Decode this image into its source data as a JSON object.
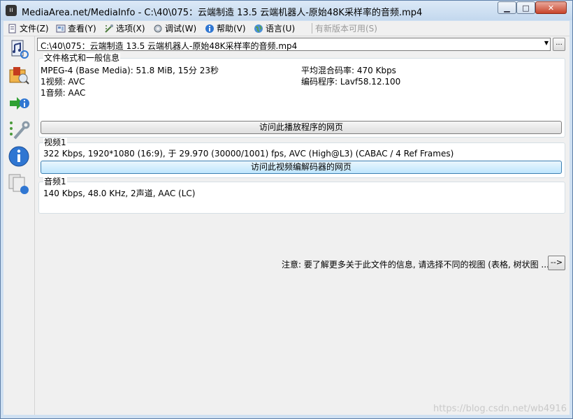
{
  "window": {
    "title": "MediaArea.net/MediaInfo - C:\\40\\075：云端制造 13.5 云端机器人-原始48K采样率的音频.mp4",
    "controls": {
      "minimize": "▁",
      "maximize": "□",
      "close": "✕"
    }
  },
  "menu": {
    "items": [
      {
        "label": "文件(Z)",
        "icon": "file-menu-icon"
      },
      {
        "label": "查看(Y)",
        "icon": "view-menu-icon"
      },
      {
        "label": "选项(X)",
        "icon": "options-menu-icon"
      },
      {
        "label": "调试(W)",
        "icon": "debug-menu-icon"
      },
      {
        "label": "帮助(V)",
        "icon": "help-menu-icon"
      },
      {
        "label": "语言(U)",
        "icon": "language-menu-icon"
      }
    ],
    "update_label": "有新版本可用(S)"
  },
  "file_select": {
    "value": "C:\\40\\075：云端制造 13.5 云端机器人-原始48K采样率的音频.mp4",
    "browse_label": "..."
  },
  "general": {
    "title": "文件格式和一般信息",
    "format": "MPEG-4 (Base Media): 51.8 MiB, 15分 23秒",
    "video_count": "1视频: AVC",
    "audio_count": "1音频: AAC",
    "bitrate": "平均混合码率: 470 Kbps",
    "encoder": "编码程序: Lavf58.12.100",
    "visit_button": "访问此播放程序的网页"
  },
  "video": {
    "title": "视频1",
    "info": "322 Kbps, 1920*1080 (16:9), 于 29.970 (30000/1001) fps, AVC (High@L3) (CABAC / 4 Ref Frames)",
    "visit_button": "访问此视频编解码器的网页"
  },
  "audio": {
    "title": "音频1",
    "info": "140 Kbps, 48.0 KHz, 2声道, AAC (LC)"
  },
  "footer": {
    "note": "注意: 要了解更多关于此文件的信息, 请选择不同的视图 (表格, 树状图 ...)",
    "more_button": "-->"
  },
  "watermark": "https://blog.csdn.net/wb4916",
  "colors": {
    "accent": "#3c7fb1",
    "close": "#c8442b",
    "titlebar": "#c3d8ee"
  }
}
